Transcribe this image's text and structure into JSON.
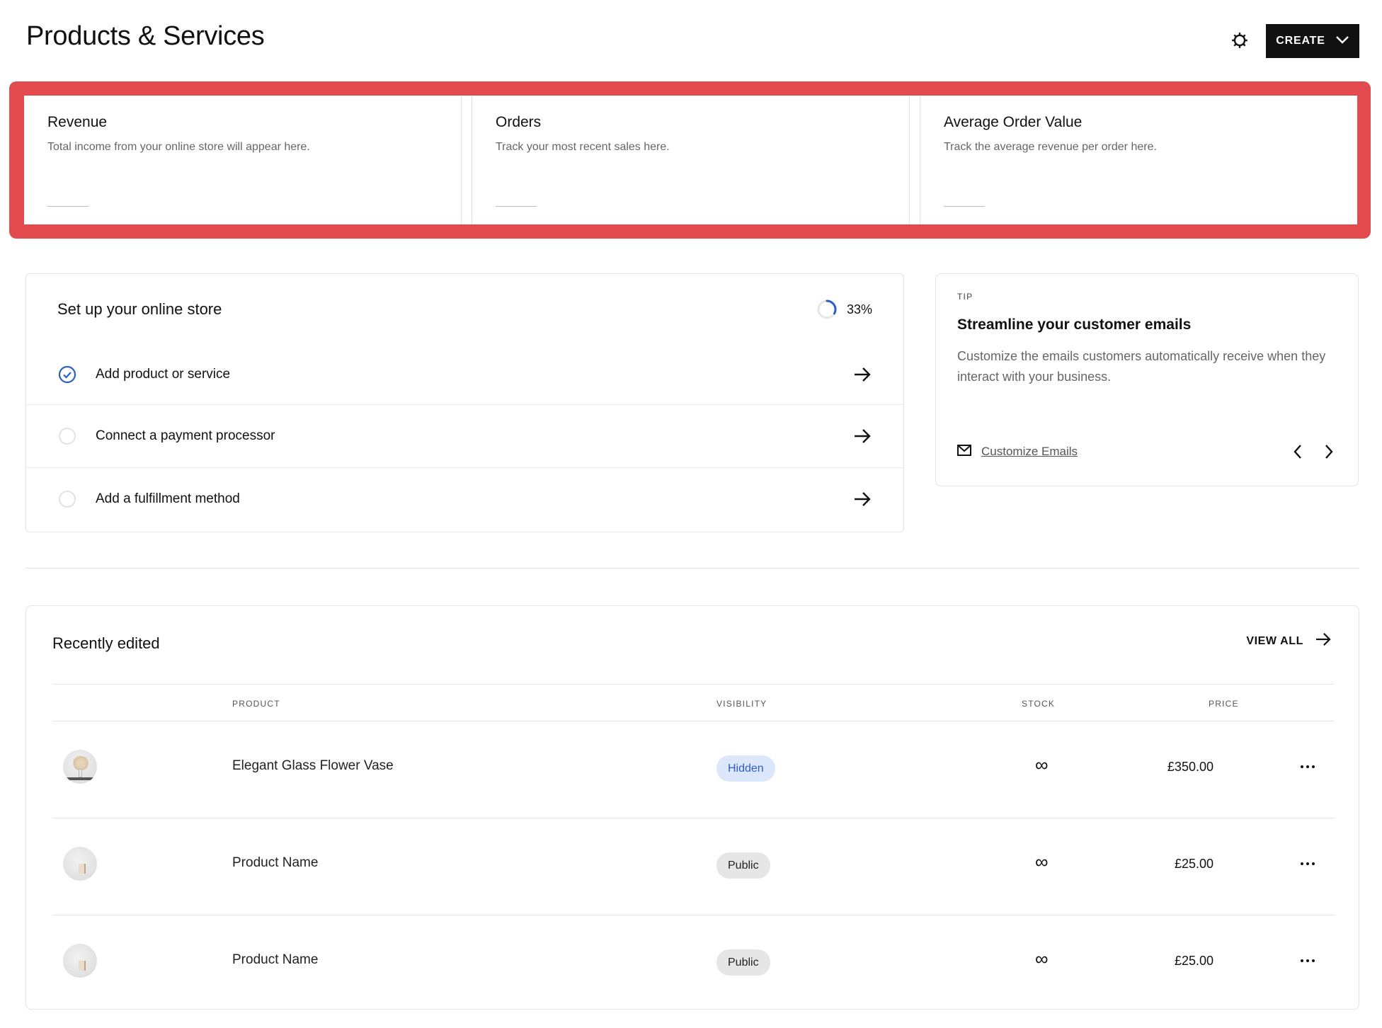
{
  "header": {
    "title": "Products & Services",
    "settings_icon": "gear-icon",
    "create_label": "CREATE"
  },
  "metrics": [
    {
      "title": "Revenue",
      "description": "Total income from your online store will appear here."
    },
    {
      "title": "Orders",
      "description": "Track your most recent sales here."
    },
    {
      "title": "Average Order Value",
      "description": "Track the average revenue per order here."
    }
  ],
  "setup": {
    "title": "Set up your online store",
    "progress_label": "33%",
    "progress_fraction": 0.33,
    "tasks": [
      {
        "label": "Add product or service",
        "done": true
      },
      {
        "label": "Connect a payment processor",
        "done": false
      },
      {
        "label": "Add a fulfillment method",
        "done": false
      }
    ]
  },
  "tip": {
    "label": "TIP",
    "title": "Streamline your customer emails",
    "body": "Customize the emails customers automatically receive when they interact with your business.",
    "link_label": "Customize Emails"
  },
  "recent": {
    "title": "Recently edited",
    "view_all_label": "VIEW ALL",
    "columns": [
      "PRODUCT",
      "VISIBILITY",
      "STOCK",
      "PRICE"
    ],
    "rows": [
      {
        "name": "Elegant Glass Flower Vase",
        "visibility": "Hidden",
        "stock": "∞",
        "price": "£350.00"
      },
      {
        "name": "Product Name",
        "visibility": "Public",
        "stock": "∞",
        "price": "£25.00"
      },
      {
        "name": "Product Name",
        "visibility": "Public",
        "stock": "∞",
        "price": "£25.00"
      }
    ]
  },
  "colors": {
    "accent_blue": "#2c5fc4",
    "highlight_red": "#e24a4d",
    "button_dark": "#111111"
  }
}
